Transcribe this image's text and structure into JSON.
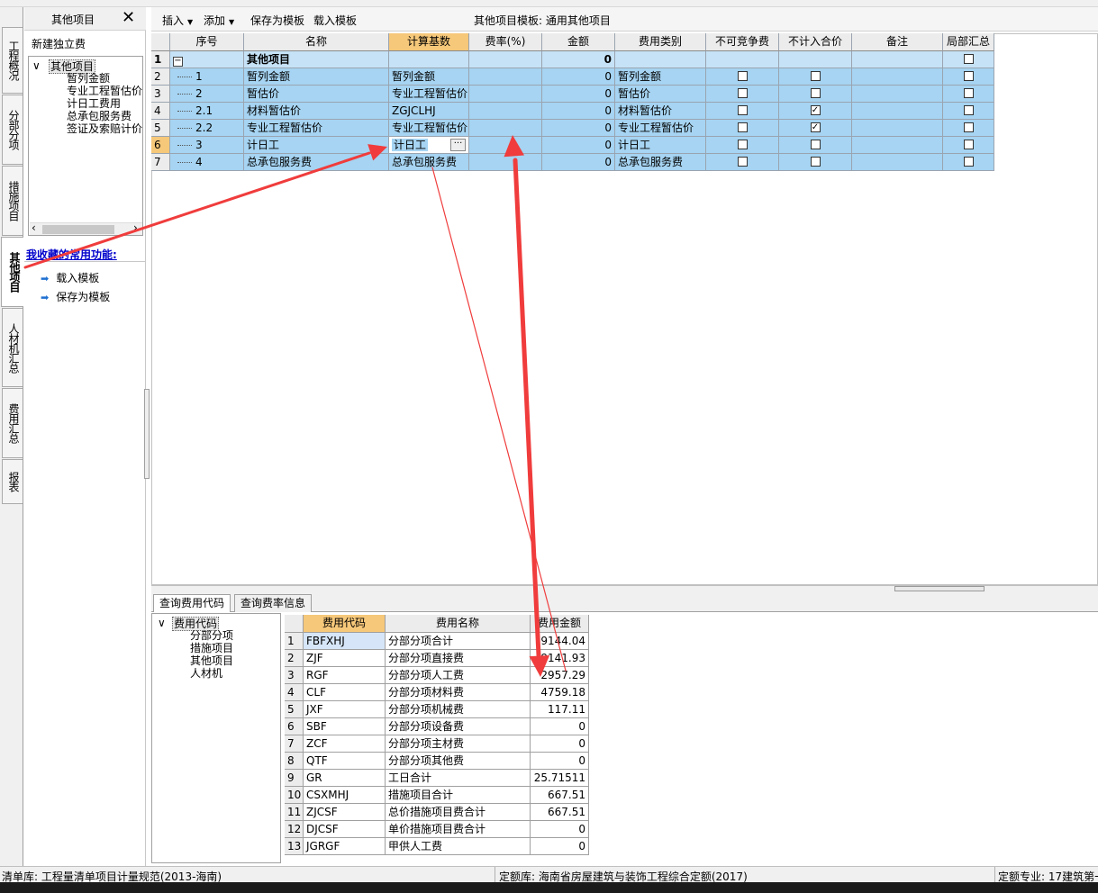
{
  "left_panel": {
    "title": "其他项目",
    "close_symbol": "✕",
    "new_label": "新建独立费",
    "tree_expander": "∨",
    "tree_root": "其他项目",
    "tree_children": [
      "暂列金额",
      "专业工程暂估价",
      "计日工费用",
      "总承包服务费",
      "签证及索赔计价"
    ],
    "scroll_left": "‹",
    "scroll_right": "›",
    "fav_title": "我收藏的常用功能:",
    "fav_arrow": "➡",
    "fav_items": [
      "载入模板",
      "保存为模板"
    ]
  },
  "vtabs": [
    "工程概况",
    "分部分项",
    "措施项目",
    "其他项目",
    "人材机汇总",
    "费用汇总",
    "报表"
  ],
  "toolbar": {
    "insert": "插入",
    "add": "添加",
    "dropdown_arrow": "▼",
    "save_tpl": "保存为模板",
    "load_tpl": "载入模板",
    "template_info": "其他项目模板: 通用其他项目"
  },
  "grid": {
    "headers": [
      "序号",
      "名称",
      "计算基数",
      "费率(%)",
      "金额",
      "费用类别",
      "不可竞争费",
      "不计入合价",
      "备注",
      "局部汇总"
    ],
    "collapse_symbol": "−",
    "check_symbol": "✓",
    "ellipsis": "···",
    "rows": [
      {
        "rn": "1",
        "seq": "",
        "name": "其他项目",
        "base": "",
        "rate": "",
        "amount": "0",
        "cat": "",
        "c1": false,
        "c2": false,
        "note": "",
        "c3": false
      },
      {
        "rn": "2",
        "seq": "1",
        "name": "暂列金额",
        "base": "暂列金额",
        "rate": "",
        "amount": "0",
        "cat": "暂列金额",
        "c1": false,
        "c2": false,
        "note": "",
        "c3": false
      },
      {
        "rn": "3",
        "seq": "2",
        "name": "暂估价",
        "base": "专业工程暂估价",
        "rate": "",
        "amount": "0",
        "cat": "暂估价",
        "c1": false,
        "c2": false,
        "note": "",
        "c3": false
      },
      {
        "rn": "4",
        "seq": "2.1",
        "name": "材料暂估价",
        "base": "ZGJCLHJ",
        "rate": "",
        "amount": "0",
        "cat": "材料暂估价",
        "c1": false,
        "c2": true,
        "note": "",
        "c3": false
      },
      {
        "rn": "5",
        "seq": "2.2",
        "name": "专业工程暂估价",
        "base": "专业工程暂估价",
        "rate": "",
        "amount": "0",
        "cat": "专业工程暂估价",
        "c1": false,
        "c2": true,
        "note": "",
        "c3": false
      },
      {
        "rn": "6",
        "seq": "3",
        "name": "计日工",
        "base": "计日工",
        "rate": "",
        "amount": "0",
        "cat": "计日工",
        "c1": false,
        "c2": false,
        "note": "",
        "c3": false
      },
      {
        "rn": "7",
        "seq": "4",
        "name": "总承包服务费",
        "base": "总承包服务费",
        "rate": "",
        "amount": "0",
        "cat": "总承包服务费",
        "c1": false,
        "c2": false,
        "note": "",
        "c3": false
      }
    ]
  },
  "bottom_tabs": [
    "查询费用代码",
    "查询费率信息"
  ],
  "bottom_tree": {
    "expander": "∨",
    "root": "费用代码",
    "children": [
      "分部分项",
      "措施项目",
      "其他项目",
      "人材机"
    ]
  },
  "code_table": {
    "headers": [
      "费用代码",
      "费用名称",
      "费用金额"
    ],
    "rows": [
      {
        "rn": "1",
        "code": "FBFXHJ",
        "name": "分部分项合计",
        "amount": "9144.04"
      },
      {
        "rn": "2",
        "code": "ZJF",
        "name": "分部分项直接费",
        "amount": "9141.93"
      },
      {
        "rn": "3",
        "code": "RGF",
        "name": "分部分项人工费",
        "amount": "2957.29"
      },
      {
        "rn": "4",
        "code": "CLF",
        "name": "分部分项材料费",
        "amount": "4759.18"
      },
      {
        "rn": "5",
        "code": "JXF",
        "name": "分部分项机械费",
        "amount": "117.11"
      },
      {
        "rn": "6",
        "code": "SBF",
        "name": "分部分项设备费",
        "amount": "0"
      },
      {
        "rn": "7",
        "code": "ZCF",
        "name": "分部分项主材费",
        "amount": "0"
      },
      {
        "rn": "8",
        "code": "QTF",
        "name": "分部分项其他费",
        "amount": "0"
      },
      {
        "rn": "9",
        "code": "GR",
        "name": "工日合计",
        "amount": "25.71511"
      },
      {
        "rn": "10",
        "code": "CSXMHJ",
        "name": "措施项目合计",
        "amount": "667.51"
      },
      {
        "rn": "11",
        "code": "ZJCSF",
        "name": "总价措施项目费合计",
        "amount": "667.51"
      },
      {
        "rn": "12",
        "code": "DJCSF",
        "name": "单价措施项目费合计",
        "amount": "0"
      },
      {
        "rn": "13",
        "code": "JGRGF",
        "name": "甲供人工费",
        "amount": "0"
      }
    ]
  },
  "status": {
    "list_lib": "清单库: 工程量清单项目计量规范(2013-海南)",
    "quota_lib": "定额库: 海南省房屋建筑与装饰工程综合定额(2017)",
    "specialty": "定额专业: 17建筑第一"
  },
  "colors": {
    "row_selected": "#a6d4f2",
    "header_active": "#f6c87a",
    "annotation_arrow": "#f03c3c"
  }
}
